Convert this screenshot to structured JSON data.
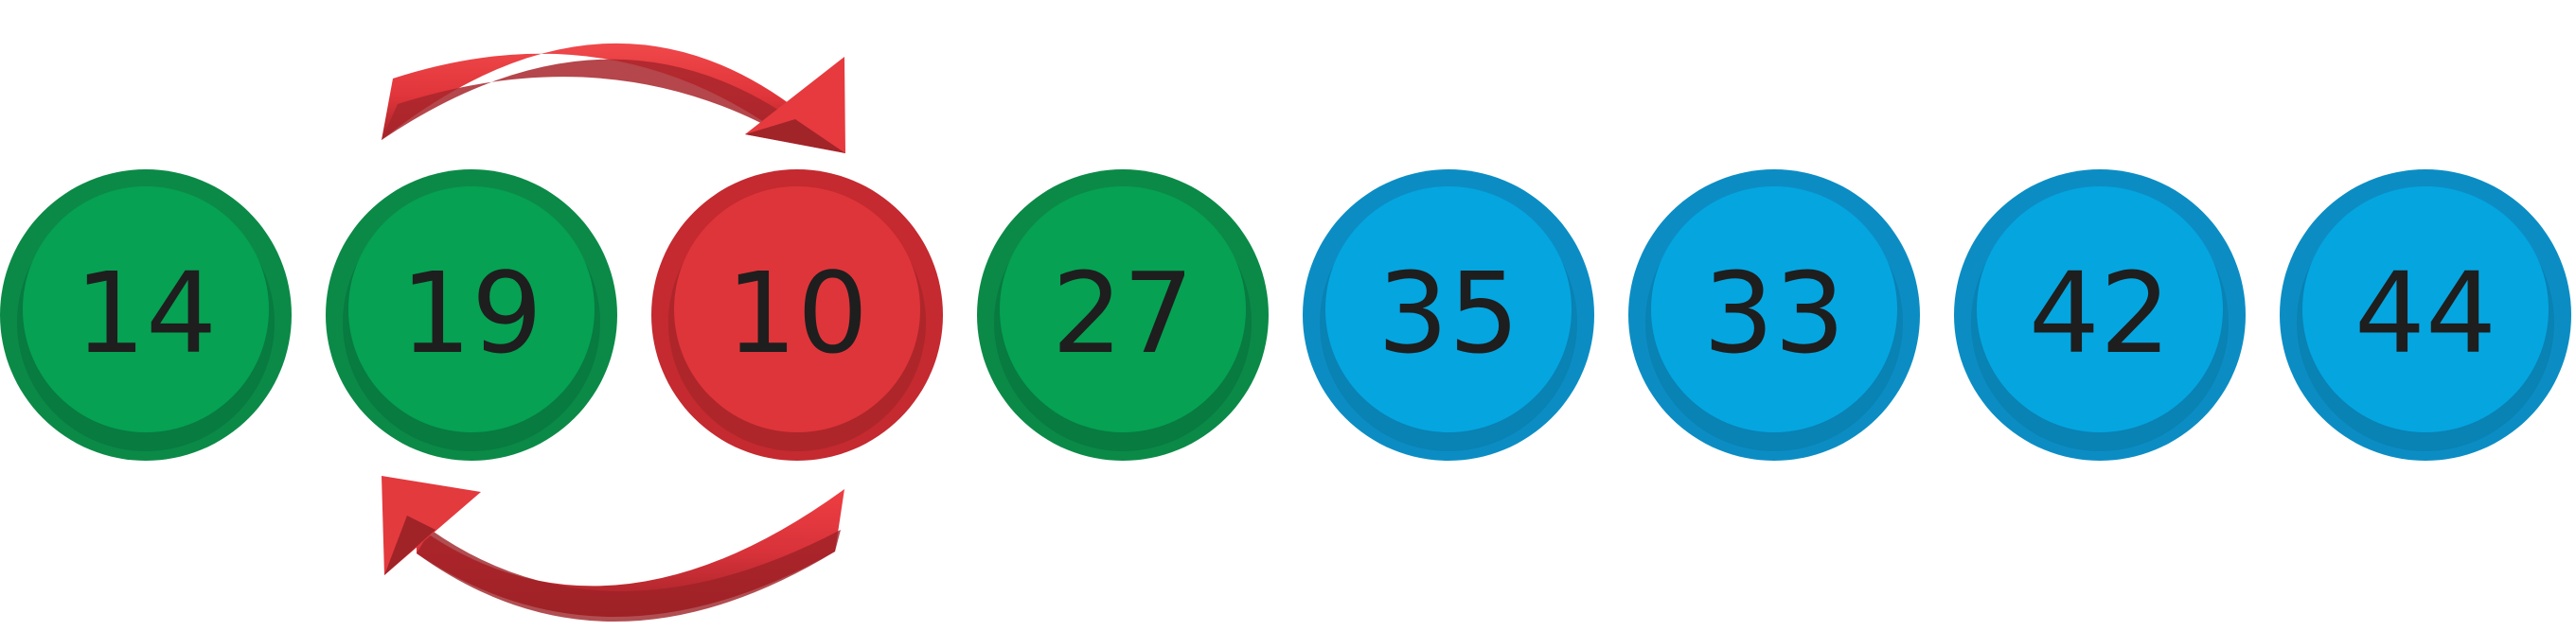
{
  "balls": [
    {
      "value": "14",
      "state": "sorted"
    },
    {
      "value": "19",
      "state": "sorted"
    },
    {
      "value": "10",
      "state": "active"
    },
    {
      "value": "27",
      "state": "sorted"
    },
    {
      "value": "35",
      "state": "unsorted"
    },
    {
      "value": "33",
      "state": "unsorted"
    },
    {
      "value": "42",
      "state": "unsorted"
    },
    {
      "value": "44",
      "state": "unsorted"
    }
  ],
  "swap": {
    "from_index": 1,
    "to_index": 2
  },
  "colors": {
    "sorted": {
      "outer": "#0b8a47",
      "inner": "#06a153",
      "shadow": "#06703a"
    },
    "active": {
      "outer": "#c42a30",
      "inner": "#de353a",
      "shadow": "#9c2227"
    },
    "unsorted": {
      "outer": "#0b8dc4",
      "inner": "#05a5e0",
      "shadow": "#0a7aa8"
    },
    "arrow": {
      "light": "#ee3a3e",
      "dark": "#a12429"
    },
    "text": "#1e1e1e"
  }
}
